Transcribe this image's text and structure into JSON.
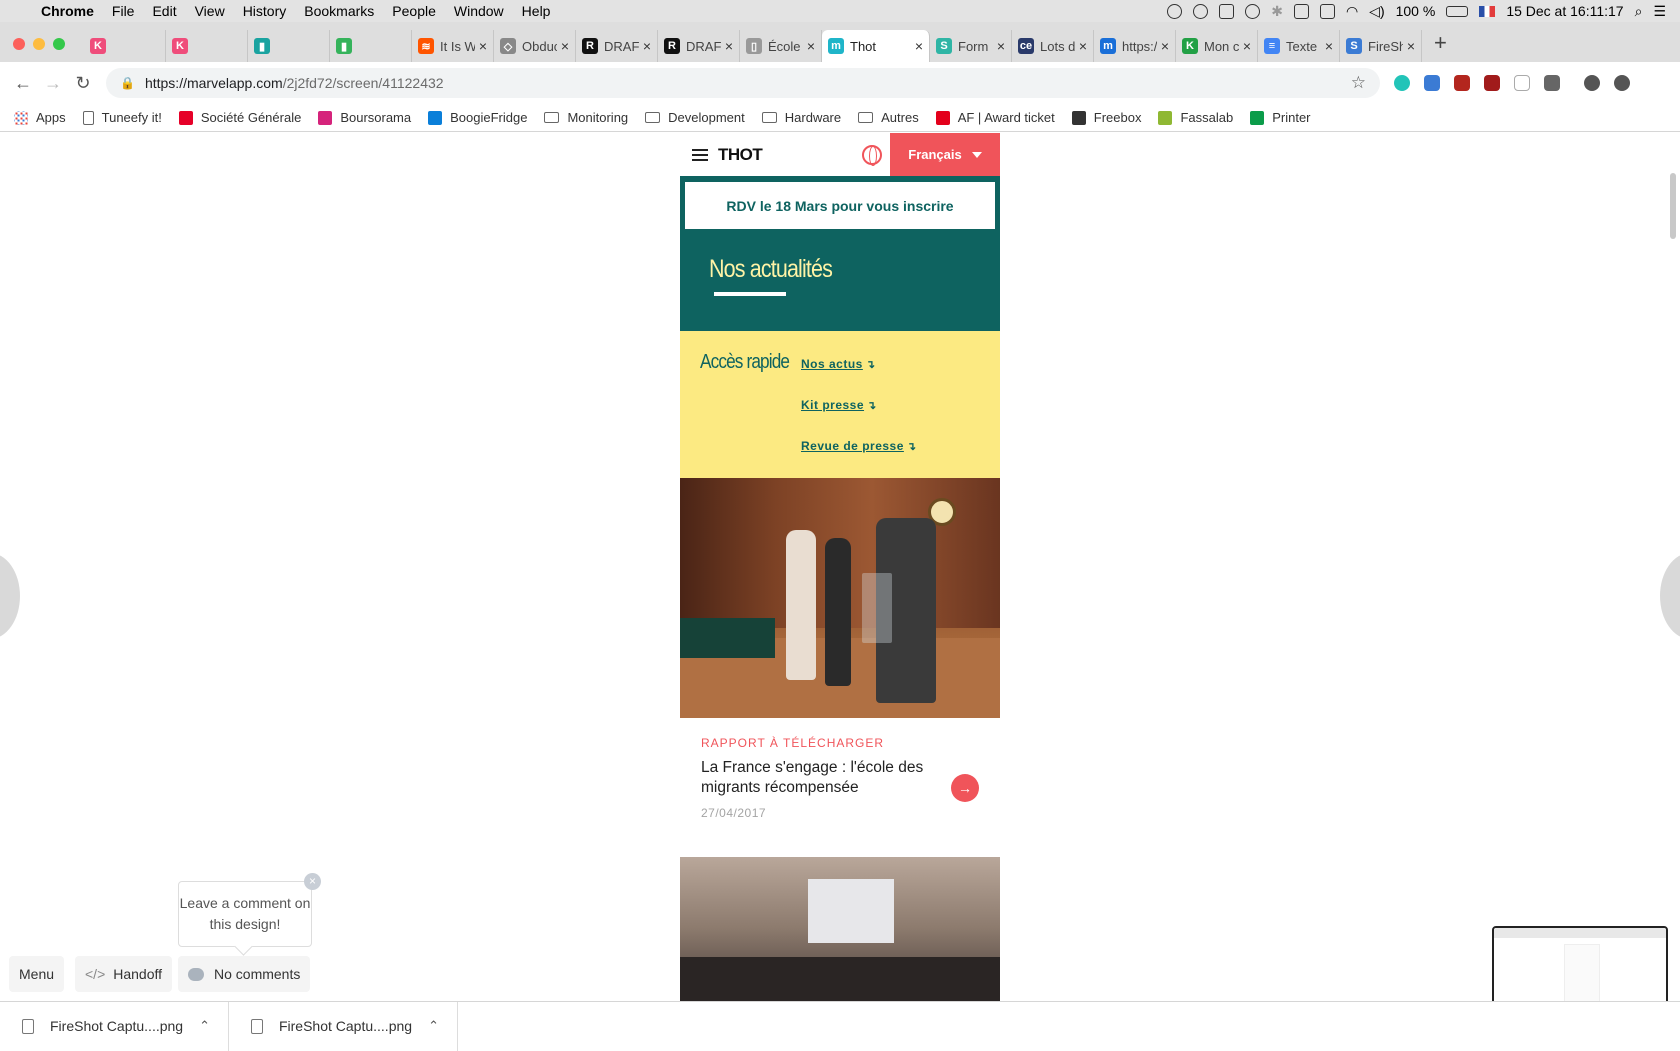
{
  "menubar": {
    "app": "Chrome",
    "items": [
      "File",
      "Edit",
      "View",
      "History",
      "Bookmarks",
      "People",
      "Window",
      "Help"
    ],
    "battery": "100 %",
    "datetime": "15 Dec at 16:11:17"
  },
  "tabs": [
    {
      "title": "",
      "fav": "K",
      "color": "#ef4d7b"
    },
    {
      "title": "",
      "fav": "K",
      "color": "#ef4d7b"
    },
    {
      "title": "",
      "fav": "▮",
      "color": "#1aa3a0"
    },
    {
      "title": "",
      "fav": "▮",
      "color": "#35b35b"
    },
    {
      "title": "It Is Wha",
      "fav": "≋",
      "color": "#ff5500"
    },
    {
      "title": "Obductio",
      "fav": "◇",
      "color": "#888888"
    },
    {
      "title": "DRAFT A",
      "fav": "R",
      "color": "#111111"
    },
    {
      "title": "DRAFT A",
      "fav": "R",
      "color": "#111111"
    },
    {
      "title": "École Th",
      "fav": "▯",
      "color": "#999999"
    },
    {
      "title": "Thot",
      "fav": "m",
      "color": "#1fb5c9",
      "active": true
    },
    {
      "title": "Form | S",
      "fav": "S",
      "color": "#2fb5a5"
    },
    {
      "title": "Lots de",
      "fav": "ce",
      "color": "#2a3a6a"
    },
    {
      "title": "https://v",
      "fav": "m",
      "color": "#1a6fd8"
    },
    {
      "title": "Mon con",
      "fav": "K",
      "color": "#22a045"
    },
    {
      "title": "Texte ret",
      "fav": "≡",
      "color": "#4285f4"
    },
    {
      "title": "FireShot",
      "fav": "S",
      "color": "#3b7bd4"
    }
  ],
  "toolbar": {
    "url_host": "https://marvelapp.com",
    "url_path": "/2j2fd72/screen/41122432"
  },
  "bookmarks": [
    {
      "label": "Apps",
      "icon": "apps-icon",
      "color": "#e8453c"
    },
    {
      "label": "Tuneefy it!",
      "icon": "page-icon",
      "color": "#ffffff"
    },
    {
      "label": "Société Générale",
      "icon": "sg-icon",
      "color": "#e60028"
    },
    {
      "label": "Boursorama",
      "icon": "boursorama-icon",
      "color": "#d5237b"
    },
    {
      "label": "BoogieFridge",
      "icon": "dsm-icon",
      "color": "#0a7fd9"
    },
    {
      "label": "Monitoring",
      "icon": "folder-icon",
      "color": ""
    },
    {
      "label": "Development",
      "icon": "folder-icon",
      "color": ""
    },
    {
      "label": "Hardware",
      "icon": "folder-icon",
      "color": ""
    },
    {
      "label": "Autres",
      "icon": "folder-icon",
      "color": ""
    },
    {
      "label": "AF | Award ticket",
      "icon": "af-icon",
      "color": "#e3001b"
    },
    {
      "label": "Freebox",
      "icon": "freebox-icon",
      "color": "#333333"
    },
    {
      "label": "Fassalab",
      "icon": "fassalab-icon",
      "color": "#8fb833"
    },
    {
      "label": "Printer",
      "icon": "printer-icon",
      "color": "#0b9c4a"
    }
  ],
  "site": {
    "logo": "THOT",
    "language": "Français",
    "rdv_banner": "RDV le 18 Mars pour vous inscrire",
    "section_title": "Nos actualités",
    "quick_title": "Accès rapide",
    "quick_links": [
      "Nos actus",
      "Kit presse",
      "Revue de presse"
    ],
    "article": {
      "category": "RAPPORT À TÉLÉCHARGER",
      "headline": "La France s'engage : l'école des migrants récompensée",
      "date": "27/04/2017"
    }
  },
  "marvel": {
    "tooltip": "Leave a comment on this design!",
    "menu_label": "Menu",
    "handoff_label": "Handoff",
    "comments_label": "No comments"
  },
  "downloads": [
    {
      "label": "FireShot Captu....png"
    },
    {
      "label": "FireShot Captu....png"
    }
  ],
  "colors": {
    "brand_green": "#0e6360",
    "brand_red": "#f0545a",
    "brand_yellow": "#fcea82"
  }
}
